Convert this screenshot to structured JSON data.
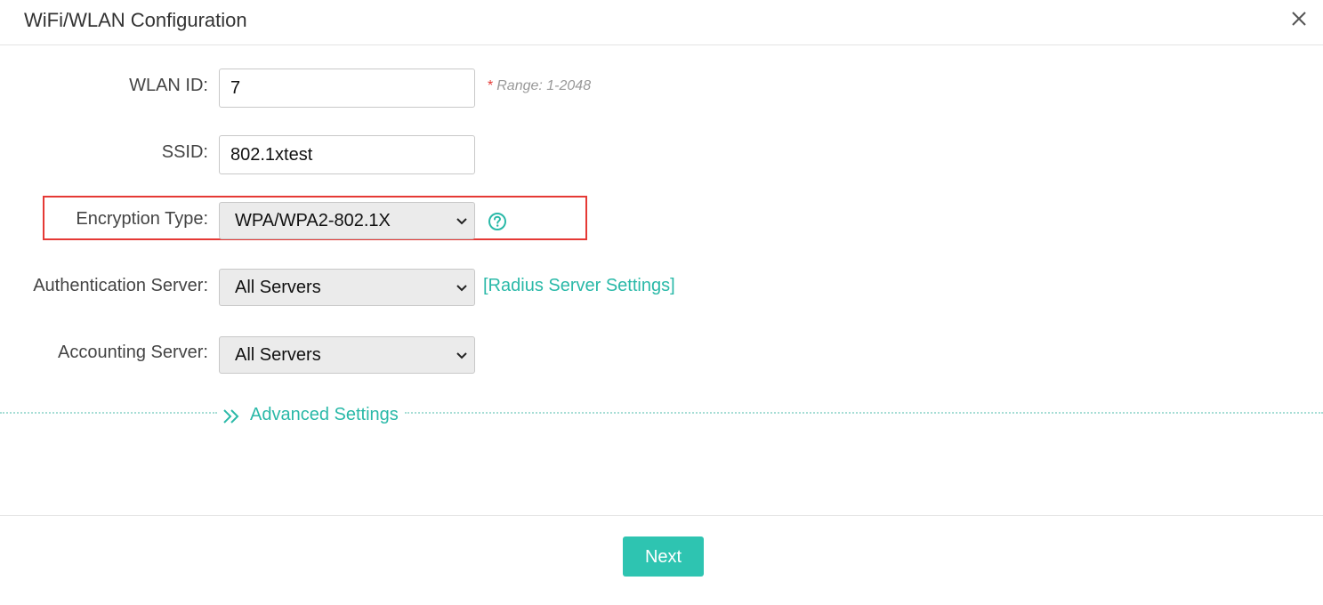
{
  "dialog": {
    "title": "WiFi/WLAN Configuration"
  },
  "form": {
    "wlan_id": {
      "label": "WLAN ID:",
      "value": "7",
      "required_mark": "*",
      "hint": "Range: 1-2048"
    },
    "ssid": {
      "label": "SSID:",
      "value": "802.1xtest"
    },
    "encryption": {
      "label": "Encryption Type:",
      "selected": "WPA/WPA2-802.1X",
      "highlighted": true
    },
    "auth_server": {
      "label": "Authentication Server:",
      "selected": "All Servers",
      "link": "[Radius Server Settings]"
    },
    "accounting_server": {
      "label": "Accounting Server:",
      "selected": "All Servers"
    },
    "advanced": {
      "label": "Advanced Settings"
    }
  },
  "footer": {
    "next_label": "Next"
  },
  "colors": {
    "accent": "#2ec4b1",
    "link": "#2ab9a8",
    "highlight": "#e53935"
  },
  "icons": {
    "close": "close-icon",
    "help": "help-circle-icon",
    "dropdown": "chevron-down-icon",
    "advanced": "double-chevron-right-icon"
  }
}
